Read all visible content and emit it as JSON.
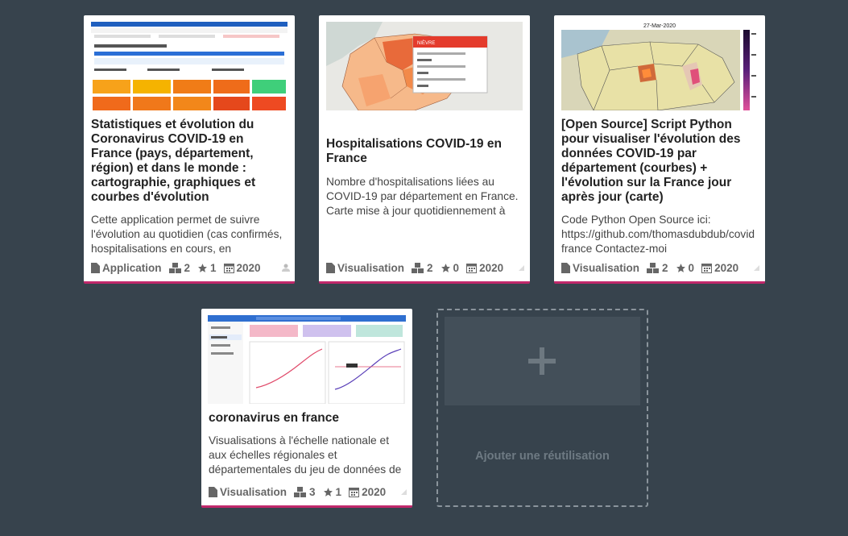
{
  "cards": [
    {
      "title": "Statistiques et évolution du Coronavirus COVID-19 en France (pays, département, région) et dans le monde : cartographie, graphiques et courbes d'évolution",
      "description": "Cette application permet de suivre l'évolution au quotidien (cas confirmés, hospitalisations en cours, en",
      "type": "Application",
      "datasets": "2",
      "stars": "1",
      "year": "2020"
    },
    {
      "title": "Hospitalisations COVID-19 en France",
      "description": "Nombre d'hospitalisations liées au COVID-19 par département en France. Carte mise à jour quotidiennement à",
      "type": "Visualisation",
      "datasets": "2",
      "stars": "0",
      "year": "2020",
      "map_popup": "NIÈVRE"
    },
    {
      "title": "[Open Source] Script Python pour visualiser l'évolution des données COVID-19 par département (courbes) + l'évolution sur la France jour après jour (carte)",
      "description": "Code Python Open Source ici: https://github.com/thomasdubdub/covid france Contactez-moi",
      "type": "Visualisation",
      "datasets": "2",
      "stars": "0",
      "year": "2020",
      "map_date": "27-Mar-2020"
    },
    {
      "title": "coronavirus en france",
      "description": "Visualisations à l'échelle nationale et aux échelles régionales et départementales du jeu de données de",
      "type": "Visualisation",
      "datasets": "3",
      "stars": "1",
      "year": "2020"
    }
  ],
  "add_card": {
    "label": "Ajouter une réutilisation",
    "icon": "plus-icon"
  },
  "colors": {
    "background": "#37434d",
    "accent": "#c0286b"
  }
}
